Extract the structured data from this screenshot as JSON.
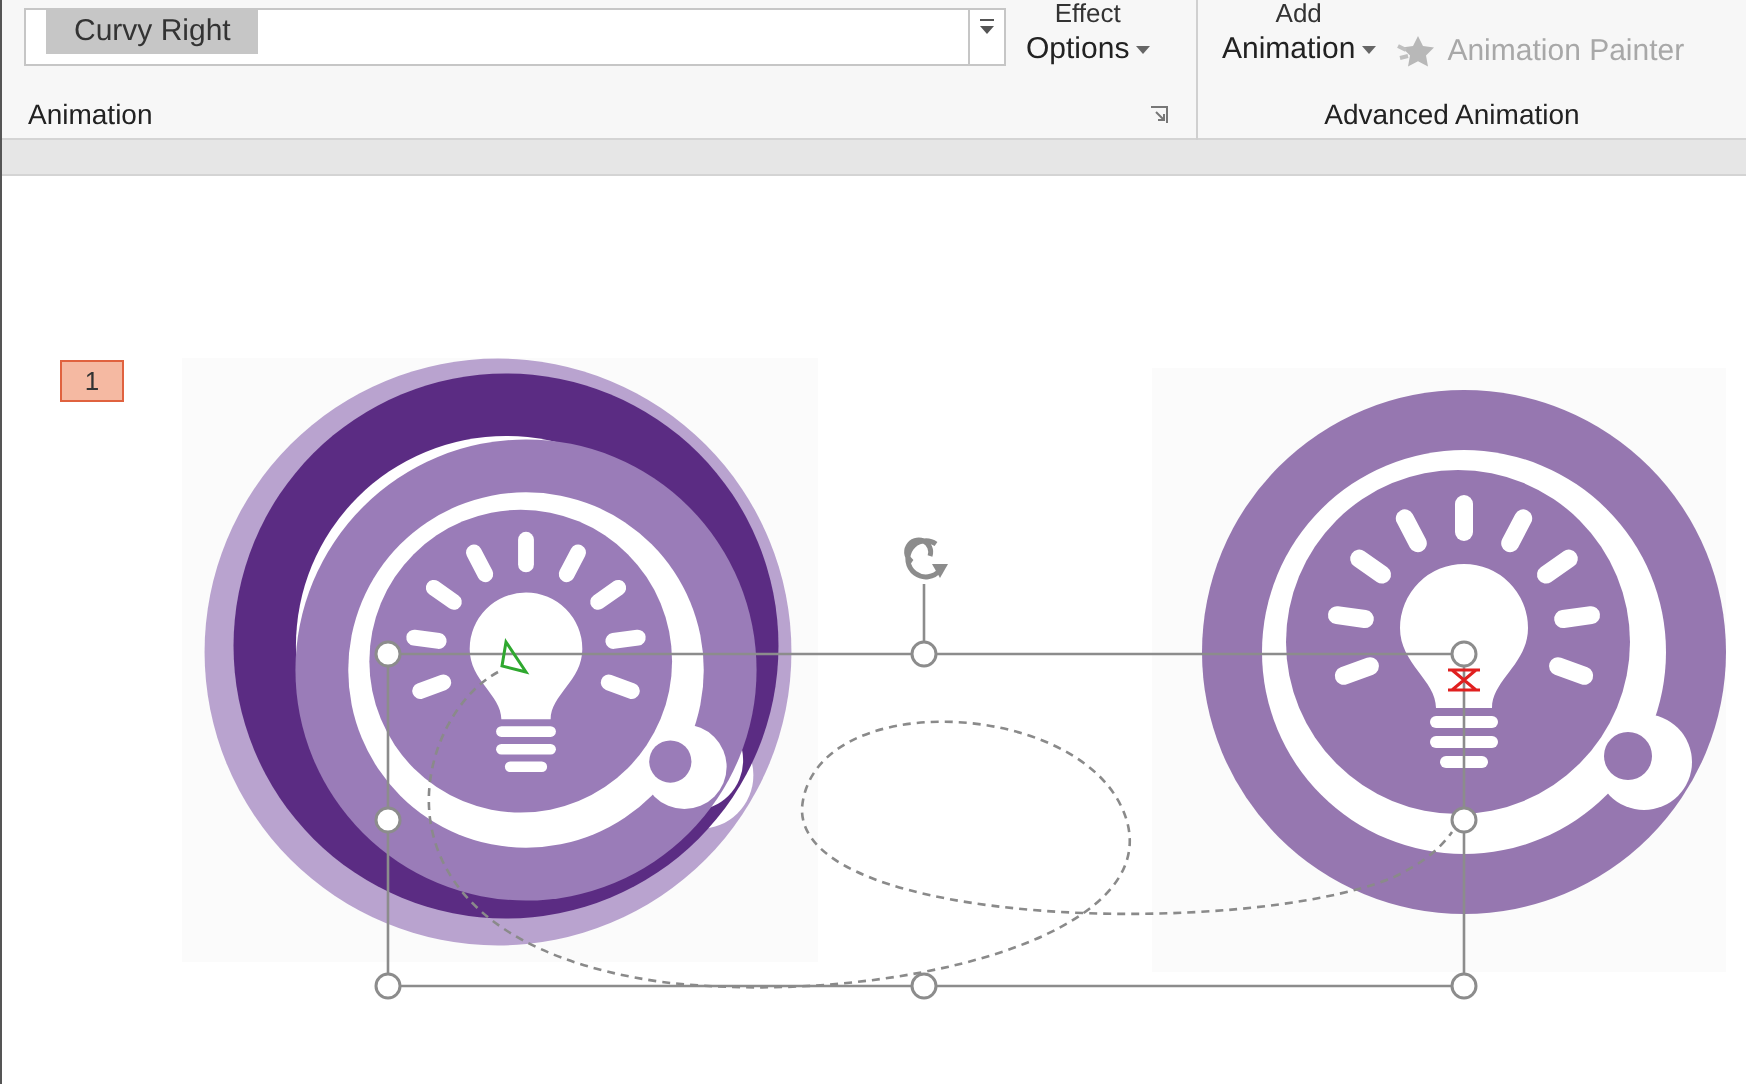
{
  "ribbon": {
    "animation_gallery": [
      {
        "label": "Curvy Right",
        "selected": true
      }
    ],
    "effect_options": {
      "top_label": "Effect",
      "label": "Options"
    },
    "add_animation": {
      "top_label": "Add",
      "label": "Animation"
    },
    "animation_painter": {
      "label": "Animation Painter",
      "disabled": true
    },
    "groups": [
      {
        "label": "Animation"
      },
      {
        "label": "Advanced Animation"
      }
    ]
  },
  "slide": {
    "animation_tags": [
      "1"
    ]
  }
}
